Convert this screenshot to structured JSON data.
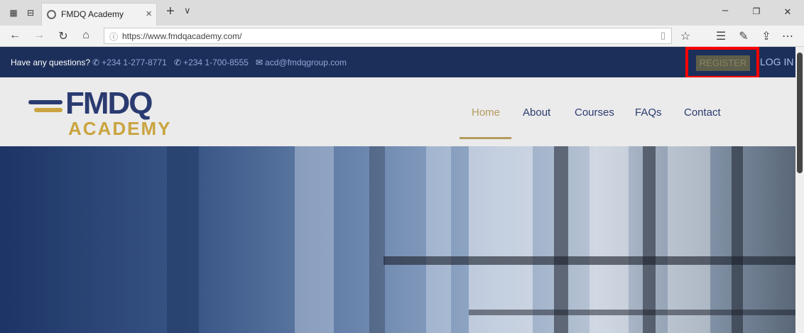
{
  "browser": {
    "tab_title": "FMDQ Academy",
    "tab_close": "×",
    "new_tab": "+",
    "tab_list": "∨",
    "url": "https://www.fmdqacademy.com/",
    "win_min": "–",
    "win_restore": "❐",
    "win_close": "✕",
    "icons": [
      "back-icon",
      "forward-icon",
      "refresh-icon",
      "home-icon",
      "favorite-star-icon",
      "favorites-list-icon",
      "pen-icon",
      "share-icon",
      "more-icon"
    ]
  },
  "infobar": {
    "question": "Have any questions?",
    "phone1": "+234 1-277-8771",
    "phone2": "+234 1-700-8555",
    "email": "acd@fmdqgroup.com",
    "register": "REGISTER",
    "login": "LOG IN",
    "highlight_color": "#ff0000"
  },
  "logo": {
    "name": "FMDQ",
    "sub": "ACADEMY",
    "brand_blue": "#2a3b70",
    "brand_gold": "#c9a440"
  },
  "menu": {
    "items": [
      "Home",
      "About",
      "Courses",
      "FAQs",
      "Contact"
    ],
    "active": "Home"
  }
}
